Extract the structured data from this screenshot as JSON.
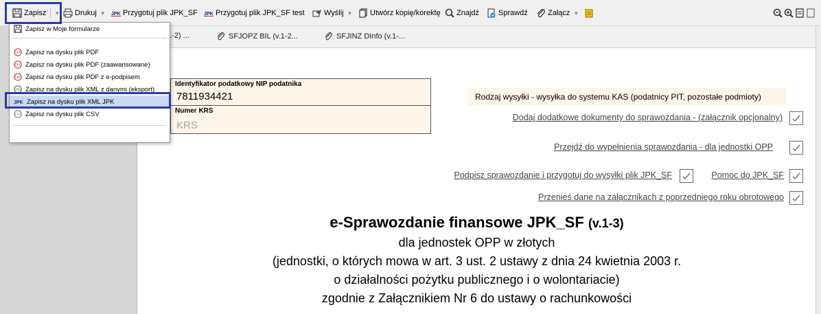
{
  "toolbar": {
    "save": "Zapisz",
    "print": "Drukuj",
    "prepare_jpk": "Przygotuj plik JPK_SF",
    "prepare_jpk_test": "Przygotuj plik JPK_SF test",
    "send": "Wyślij",
    "copy": "Utwórz kopię/korektę",
    "find": "Znajdź",
    "check": "Sprawdź",
    "attach": "Załącz"
  },
  "save_menu": {
    "items": [
      "Zapisz w Moje formularze",
      "Zapisz na dysku plik PDF",
      "Zapisz na dysku plik PDF (zaawansowane)",
      "Zapisz na dysku plik PDF z e-podpisem",
      "Zapisz na dysku plik XML z danymi (eksport)",
      "Zapisz na dysku plik XML JPK",
      "Zapisz na dysku plik CSV"
    ],
    "selected": "Zapisz na dysku plik XML JPK"
  },
  "tabs": [
    "1-2) ...",
    "SFJOPZ BIL (v.1-2...",
    "SFJINZ DInfo (v.1-..."
  ],
  "form": {
    "nip_label": "Identyfikator podatkowy NIP podatnika",
    "nip_value": "7811934421",
    "krs_label": "Numer KRS",
    "krs_placeholder": "KRS",
    "rodzaj": "Rodzaj wysyłki - wysyłka do systemu KAS (podatnicy PIT, pozostałe podmioty)",
    "link_dodaj": "Dodaj dodatkowe dokumenty do sprawozdania - (załącznik opcjonalny)",
    "link_przejdz": "Przejdź do wypełnienia sprawozdania - dla jednostki OPP",
    "link_podpisz": "Podpisz sprawozdanie i przygotuj do wysyłki plik JPK_SF",
    "link_pomoc": "Pomoc do JPK_SF",
    "link_przenies": "Przenieś dane na załącznikach z poprzedniego roku obrotowego"
  },
  "document": {
    "title": "e-Sprawozdanie finansowe JPK_SF",
    "version": "(v.1-3)",
    "line1": "dla jednostek OPP w złotych",
    "line2": "(jednostki, o których mowa w art. 3 ust. 2 ustawy z dnia 24 kwietnia 2003 r.",
    "line3": "o działalności pożytku publicznego i o wolontariacie)",
    "line4": "zgodnie z Załącznikiem Nr 6 do ustawy o rachunkowości"
  },
  "colors": {
    "highlight": "#2a3ba8",
    "field_bg": "#fdf6e8",
    "selected_item": "#c9d9f2"
  }
}
